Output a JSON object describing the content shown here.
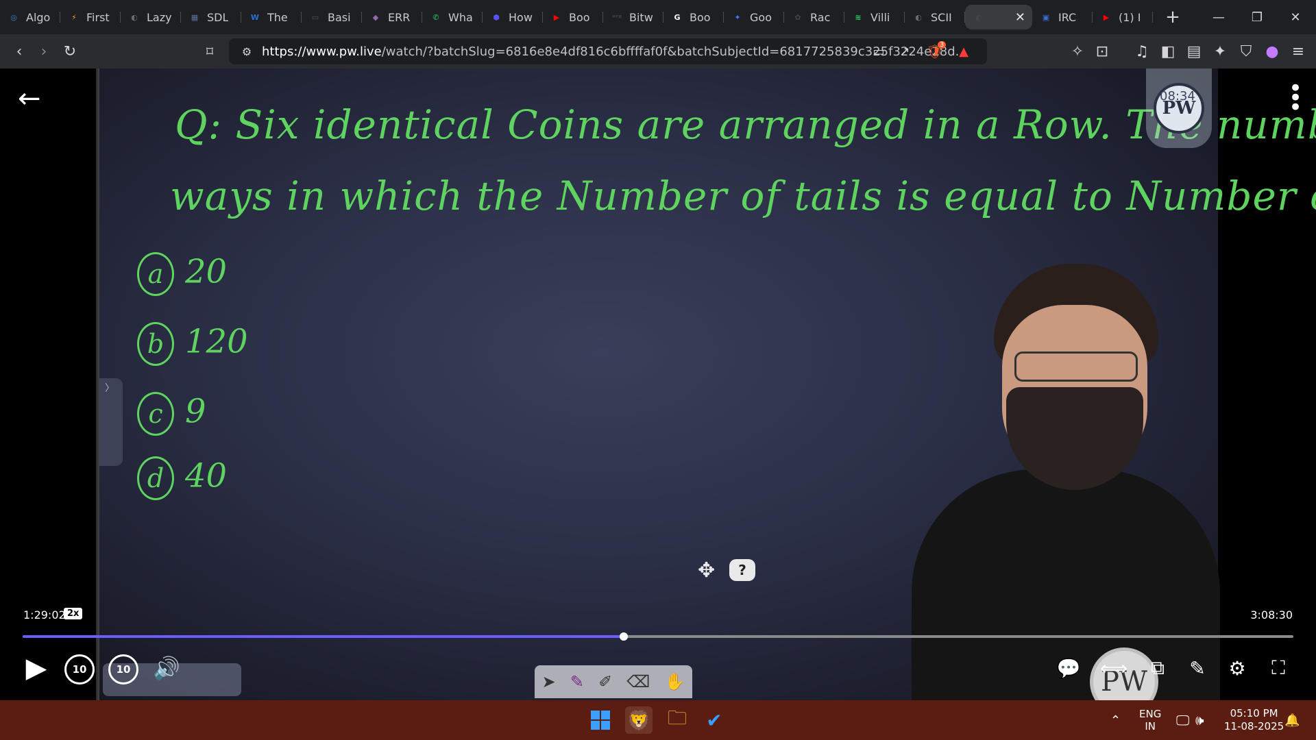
{
  "browser": {
    "tabs": [
      {
        "title": "Algo",
        "color": "#3b82c4",
        "glyph": "◎"
      },
      {
        "title": "First",
        "color": "#f0a020",
        "glyph": "⚡"
      },
      {
        "title": "Lazy",
        "color": "#6b6b6b",
        "glyph": "◐"
      },
      {
        "title": "SDL",
        "color": "#5a6fa0",
        "glyph": "▦"
      },
      {
        "title": "The",
        "color": "#2a6fd1",
        "glyph": "W"
      },
      {
        "title": "Basi",
        "color": "#555",
        "glyph": "▭"
      },
      {
        "title": "ERR",
        "color": "#8e6bb0",
        "glyph": "◆"
      },
      {
        "title": "Wha",
        "color": "#25d366",
        "glyph": "✆"
      },
      {
        "title": "How",
        "color": "#5a4ff0",
        "glyph": "⬢"
      },
      {
        "title": "Boo",
        "color": "#ff0000",
        "glyph": "▶"
      },
      {
        "title": "Bitw",
        "color": "#444",
        "glyph": "ᵒʳᵍ"
      },
      {
        "title": "Boo",
        "color": "#ffffff",
        "glyph": "G"
      },
      {
        "title": "Goo",
        "color": "#3b7bff",
        "glyph": "✦"
      },
      {
        "title": "Rac",
        "color": "#444",
        "glyph": "✿"
      },
      {
        "title": "Villi",
        "color": "#1ed760",
        "glyph": "≋"
      },
      {
        "title": "SCII",
        "color": "#6b6b6b",
        "glyph": "◐"
      },
      {
        "title": "",
        "color": "#444",
        "glyph": "◐",
        "active": true
      },
      {
        "title": "IRC",
        "color": "#3a6bd1",
        "glyph": "▣"
      },
      {
        "title": "(1) I",
        "color": "#ff0000",
        "glyph": "▶"
      }
    ],
    "url_host": "https://www.pw.live",
    "url_rest": "/watch/?batchSlug=6816e8e4df816c6bffffaf0f&batchSubjectId=6817725839c325f3224e28d...",
    "shield_count": "3"
  },
  "lecture": {
    "question_line1": "Q: Six identical Coins are arranged in a Row. The number of",
    "question_line2": "ways in which the Number of tails is equal to Number of Heads is ?",
    "options": [
      {
        "label": "a",
        "value": "20"
      },
      {
        "label": "b",
        "value": "120"
      },
      {
        "label": "c",
        "value": "9"
      },
      {
        "label": "d",
        "value": "40"
      }
    ],
    "logo_letters": "PW",
    "logo_overlay_text": "08:34"
  },
  "player": {
    "current_time": "1:29:02",
    "speed": "2x",
    "total_time": "3:08:30",
    "progress_fraction": 0.473,
    "skip_back_label": "10",
    "skip_fwd_label": "10",
    "help_label": "?"
  },
  "taskbar": {
    "lang_line1": "ENG",
    "lang_line2": "IN",
    "time": "05:10 PM",
    "date": "11-08-2025"
  }
}
